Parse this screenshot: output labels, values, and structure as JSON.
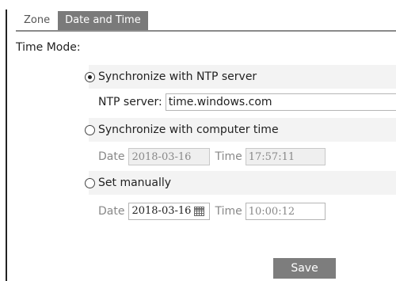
{
  "tabs": [
    {
      "label": "Zone",
      "active": false
    },
    {
      "label": "Date and Time",
      "active": true
    }
  ],
  "section": {
    "label": "Time Mode:"
  },
  "ntp": {
    "radio_label": "Synchronize with NTP server",
    "selected": true,
    "server_label": "NTP server:",
    "server_value": "time.windows.com"
  },
  "computer_time": {
    "radio_label": "Synchronize with computer time",
    "selected": false,
    "date_label": "Date",
    "date_value": "2018-03-16",
    "time_label": "Time",
    "time_value": "17:57:11"
  },
  "manual": {
    "radio_label": "Set manually",
    "selected": false,
    "date_label": "Date",
    "date_value": "2018-03-16",
    "time_label": "Time",
    "time_value": "10:00:12",
    "calendar_icon": "calendar-icon"
  },
  "actions": {
    "save_label": "Save"
  },
  "colors": {
    "active_tab": "#7a7a7a",
    "button": "#7d7d7d",
    "row_band": "#f3f3f3"
  }
}
